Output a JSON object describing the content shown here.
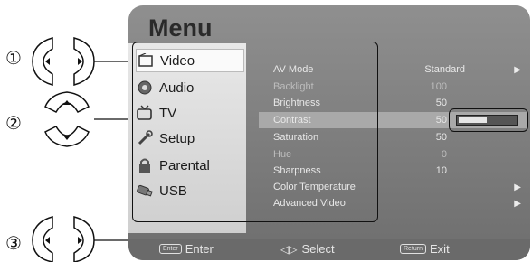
{
  "menu": {
    "title": "Menu"
  },
  "sidebar": {
    "items": [
      {
        "label": "Video",
        "icon": "video-icon"
      },
      {
        "label": "Audio",
        "icon": "audio-icon"
      },
      {
        "label": "TV",
        "icon": "tv-icon"
      },
      {
        "label": "Setup",
        "icon": "setup-icon"
      },
      {
        "label": "Parental",
        "icon": "lock-icon"
      },
      {
        "label": "USB",
        "icon": "usb-icon"
      }
    ]
  },
  "video": {
    "rows": [
      {
        "label": "AV Mode",
        "value": "Standard",
        "arrow": "▶"
      },
      {
        "label": "Backlight",
        "value": "100"
      },
      {
        "label": "Brightness",
        "value": "50"
      },
      {
        "label": "Contrast",
        "value": "50"
      },
      {
        "label": "Saturation",
        "value": "50"
      },
      {
        "label": "Hue",
        "value": "0"
      },
      {
        "label": "Sharpness",
        "value": "10"
      },
      {
        "label": "Color Temperature",
        "value": "",
        "arrow": "▶"
      },
      {
        "label": "Advanced Video",
        "value": "",
        "arrow": "▶"
      }
    ],
    "contrast_level": 0.5
  },
  "footer": {
    "enter_key": "Enter",
    "enter_label": "Enter",
    "select_label": "Select",
    "return_key": "Return",
    "exit_label": "Exit"
  },
  "callouts": {
    "one": "①",
    "two": "②",
    "three": "③"
  }
}
